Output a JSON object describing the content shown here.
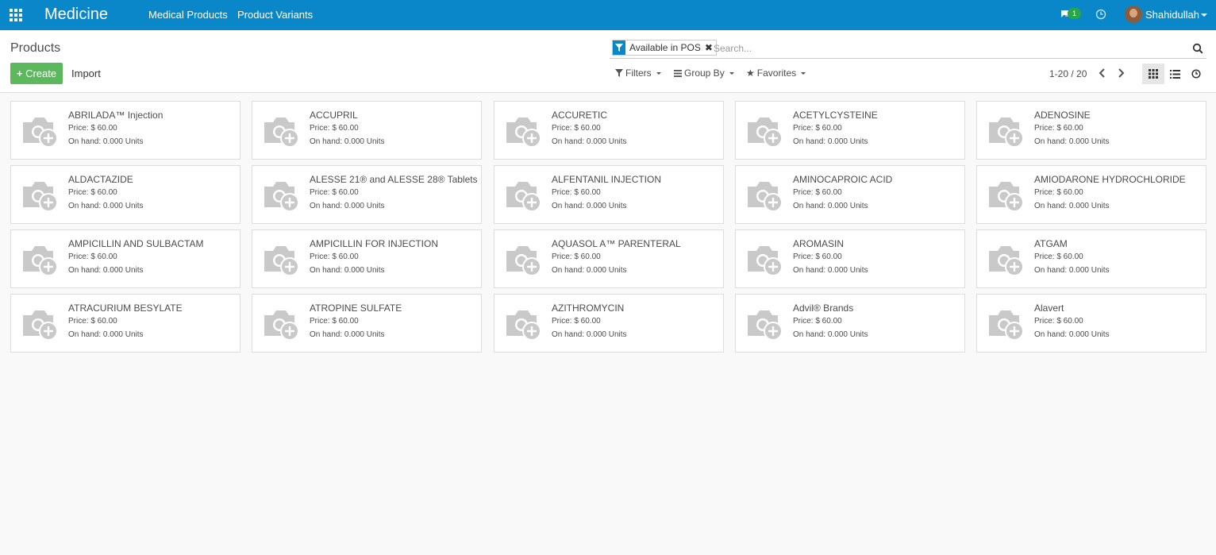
{
  "navbar": {
    "app_title": "Medicine",
    "menus": [
      "Medical Products",
      "Product Variants"
    ],
    "message_badge": "1",
    "user_name": "Shahidullah"
  },
  "control": {
    "breadcrumb": "Products",
    "create_label": "Create",
    "import_label": "Import",
    "facet_label": "Available in POS",
    "search_placeholder": "Search...",
    "filters_label": "Filters",
    "groupby_label": "Group By",
    "favorites_label": "Favorites",
    "pager": "1-20 / 20"
  },
  "products": [
    {
      "name": "ABRILADA™ Injection",
      "price": "Price: $ 60.00",
      "onhand": "On hand: 0.000 Units"
    },
    {
      "name": "ACCUPRIL",
      "price": "Price: $ 60.00",
      "onhand": "On hand: 0.000 Units"
    },
    {
      "name": "ACCURETIC",
      "price": "Price: $ 60.00",
      "onhand": "On hand: 0.000 Units"
    },
    {
      "name": "ACETYLCYSTEINE",
      "price": "Price: $ 60.00",
      "onhand": "On hand: 0.000 Units"
    },
    {
      "name": "ADENOSINE",
      "price": "Price: $ 60.00",
      "onhand": "On hand: 0.000 Units"
    },
    {
      "name": "ALDACTAZIDE",
      "price": "Price: $ 60.00",
      "onhand": "On hand: 0.000 Units"
    },
    {
      "name": "ALESSE 21® and ALESSE 28® Tablets",
      "price": "Price: $ 60.00",
      "onhand": "On hand: 0.000 Units"
    },
    {
      "name": "ALFENTANIL INJECTION",
      "price": "Price: $ 60.00",
      "onhand": "On hand: 0.000 Units"
    },
    {
      "name": "AMINOCAPROIC ACID",
      "price": "Price: $ 60.00",
      "onhand": "On hand: 0.000 Units"
    },
    {
      "name": "AMIODARONE HYDROCHLORIDE",
      "price": "Price: $ 60.00",
      "onhand": "On hand: 0.000 Units"
    },
    {
      "name": "AMPICILLIN AND SULBACTAM",
      "price": "Price: $ 60.00",
      "onhand": "On hand: 0.000 Units"
    },
    {
      "name": "AMPICILLIN FOR INJECTION",
      "price": "Price: $ 60.00",
      "onhand": "On hand: 0.000 Units"
    },
    {
      "name": "AQUASOL A™ PARENTERAL",
      "price": "Price: $ 60.00",
      "onhand": "On hand: 0.000 Units"
    },
    {
      "name": "AROMASIN",
      "price": "Price: $ 60.00",
      "onhand": "On hand: 0.000 Units"
    },
    {
      "name": "ATGAM",
      "price": "Price: $ 60.00",
      "onhand": "On hand: 0.000 Units"
    },
    {
      "name": "ATRACURIUM BESYLATE",
      "price": "Price: $ 60.00",
      "onhand": "On hand: 0.000 Units"
    },
    {
      "name": "ATROPINE SULFATE",
      "price": "Price: $ 60.00",
      "onhand": "On hand: 0.000 Units"
    },
    {
      "name": "AZITHROMYCIN",
      "price": "Price: $ 60.00",
      "onhand": "On hand: 0.000 Units"
    },
    {
      "name": "Advil® Brands",
      "price": "Price: $ 60.00",
      "onhand": "On hand: 0.000 Units"
    },
    {
      "name": "Alavert",
      "price": "Price: $ 60.00",
      "onhand": "On hand: 0.000 Units"
    }
  ]
}
